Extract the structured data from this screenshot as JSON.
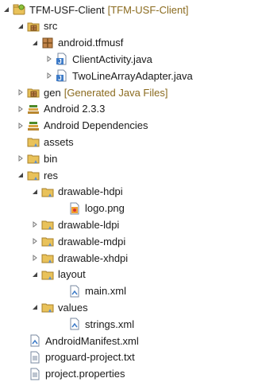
{
  "tree": {
    "project": {
      "label": "TFM-USF-Client",
      "decoration": "[TFM-USF-Client]"
    },
    "src": {
      "label": "src"
    },
    "package": {
      "label": "android.tfmusf"
    },
    "client_activity": {
      "label": "ClientActivity.java"
    },
    "two_line": {
      "label": "TwoLineArrayAdapter.java"
    },
    "gen": {
      "label": "gen",
      "decoration": "[Generated Java Files]"
    },
    "android_233": {
      "label": "Android 2.3.3"
    },
    "android_deps": {
      "label": "Android Dependencies"
    },
    "assets": {
      "label": "assets"
    },
    "bin": {
      "label": "bin"
    },
    "res": {
      "label": "res"
    },
    "drawable_hdpi": {
      "label": "drawable-hdpi"
    },
    "logo": {
      "label": "logo.png"
    },
    "drawable_ldpi": {
      "label": "drawable-ldpi"
    },
    "drawable_mdpi": {
      "label": "drawable-mdpi"
    },
    "drawable_xhdpi": {
      "label": "drawable-xhdpi"
    },
    "layout": {
      "label": "layout"
    },
    "main_xml": {
      "label": "main.xml"
    },
    "values": {
      "label": "values"
    },
    "strings_xml": {
      "label": "strings.xml"
    },
    "manifest": {
      "label": "AndroidManifest.xml"
    },
    "proguard": {
      "label": "proguard-project.txt"
    },
    "project_props": {
      "label": "project.properties"
    }
  },
  "colors": {
    "folder": "#e9c25a",
    "java": "#3f7cc8",
    "library": "#b8862e",
    "decoration": "#8a6a1e"
  }
}
